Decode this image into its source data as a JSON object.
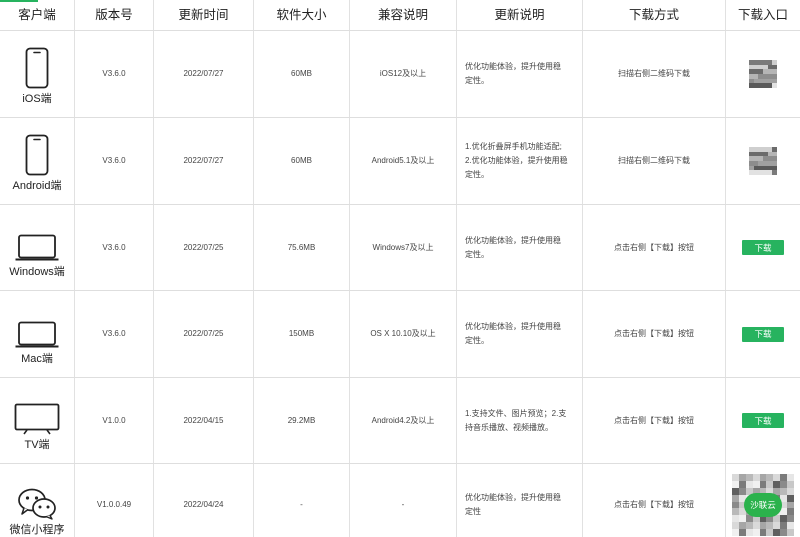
{
  "headers": [
    "客户端",
    "版本号",
    "更新时间",
    "软件大小",
    "兼容说明",
    "更新说明",
    "下载方式",
    "下载入口"
  ],
  "colors": {
    "accent": "#27b35f",
    "border": "#dedede",
    "text": "#444444"
  },
  "rows": [
    {
      "client": "iOS端",
      "icon": "phone-icon",
      "version": "V3.6.0",
      "date": "2022/07/27",
      "size": "60MB",
      "compat": "iOS12及以上",
      "notes": [
        "优化功能体验，提升使用稳",
        "定性。"
      ],
      "method": "扫描右侧二维码下载",
      "entry_type": "qr"
    },
    {
      "client": "Android端",
      "icon": "phone-icon",
      "version": "V3.6.0",
      "date": "2022/07/27",
      "size": "60MB",
      "compat": "Android5.1及以上",
      "notes": [
        "1.优化折叠屏手机功能适配;",
        "2.优化功能体验，提升使用稳",
        "定性。"
      ],
      "method": "扫描右侧二维码下载",
      "entry_type": "qr"
    },
    {
      "client": "Windows端",
      "icon": "laptop-icon",
      "version": "V3.6.0",
      "date": "2022/07/25",
      "size": "75.6MB",
      "compat": "Windows7及以上",
      "notes": [
        "优化功能体验，提升使用稳",
        "定性。"
      ],
      "method": "点击右侧【下载】按钮",
      "entry_type": "button",
      "button_label": "下载"
    },
    {
      "client": "Mac端",
      "icon": "laptop-icon",
      "version": "V3.6.0",
      "date": "2022/07/25",
      "size": "150MB",
      "compat": "OS X 10.10及以上",
      "notes": [
        "优化功能体验，提升使用稳",
        "定性。"
      ],
      "method": "点击右侧【下载】按钮",
      "entry_type": "button",
      "button_label": "下载"
    },
    {
      "client": "TV端",
      "icon": "tv-icon",
      "version": "V1.0.0",
      "date": "2022/04/15",
      "size": "29.2MB",
      "compat": "Android4.2及以上",
      "notes": [
        "1.支持文件、图片预览；2.支",
        "持音乐播放、视频播放。"
      ],
      "method": "点击右侧【下载】按钮",
      "entry_type": "button",
      "button_label": "下载"
    },
    {
      "client": "微信小程序",
      "icon": "wechat-icon",
      "version": "V1.0.0.49",
      "date": "2022/04/24",
      "size": "-",
      "compat": "-",
      "notes": [
        "优化功能体验，提升使用稳",
        "定性"
      ],
      "method": "点击右侧【下载】按钮",
      "entry_type": "qr-large",
      "badge": "沙联云"
    }
  ]
}
